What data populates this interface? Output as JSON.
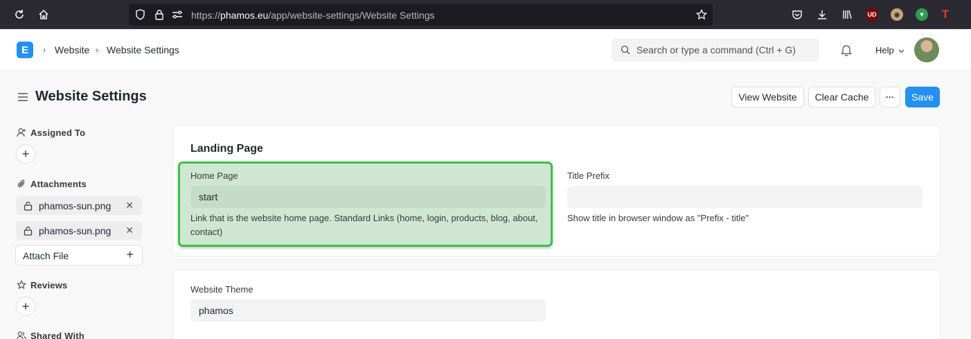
{
  "browser": {
    "url_prefix": "https://",
    "url_domain": "phamos.eu",
    "url_path": "/app/website-settings/Website Settings",
    "ext_ud": "UD",
    "ext_t": "T"
  },
  "navbar": {
    "logo": "E",
    "breadcrumbs": [
      "Website",
      "Website Settings"
    ],
    "search_placeholder": "Search or type a command (Ctrl + G)",
    "help_label": "Help"
  },
  "page": {
    "title": "Website Settings",
    "buttons": {
      "view_website": "View Website",
      "clear_cache": "Clear Cache",
      "more": "···",
      "save": "Save"
    }
  },
  "sidebar": {
    "assigned_to": "Assigned To",
    "attachments": "Attachments",
    "attachment_files": [
      "phamos-sun.png",
      "phamos-sun.png"
    ],
    "attach_file": "Attach File",
    "reviews": "Reviews",
    "shared_with": "Shared With"
  },
  "landing": {
    "section_title": "Landing Page",
    "home_page_label": "Home Page",
    "home_page_value": "start",
    "home_page_desc": "Link that is the website home page. Standard Links (home, login, products, blog, about, contact)",
    "title_prefix_label": "Title Prefix",
    "title_prefix_value": "",
    "title_prefix_desc": "Show title in browser window as \"Prefix - title\""
  },
  "theme": {
    "label": "Website Theme",
    "value": "phamos"
  },
  "colors": {
    "primary": "#2490ef",
    "highlight_border": "#3ac24a",
    "highlight_fill": "#cfe6d3"
  }
}
